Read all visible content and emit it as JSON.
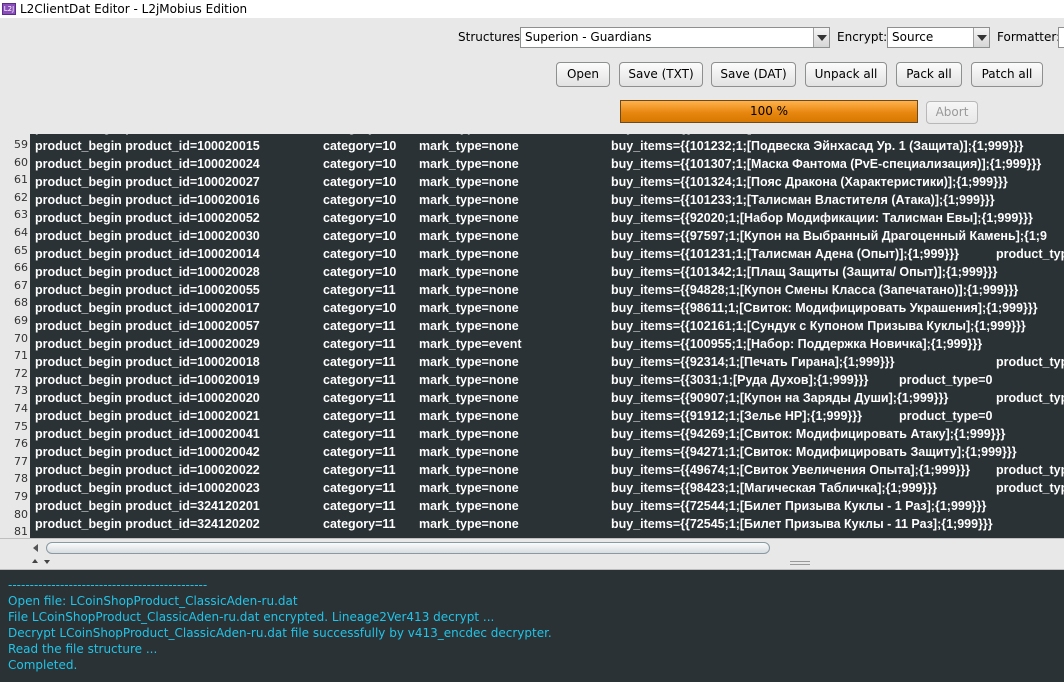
{
  "window": {
    "icon_text": "L2J",
    "title": "L2ClientDat Editor - L2jMobius Edition"
  },
  "toolbar": {
    "structures_label": "Structures",
    "structures_value": "Superion - Guardians",
    "encrypt_label": "Encrypt:",
    "encrypt_value": "Source",
    "formatter_label": "Formatter:",
    "buttons": {
      "open": "Open",
      "save_txt": "Save (TXT)",
      "save_dat": "Save (DAT)",
      "unpack_all": "Unpack all",
      "pack_all": "Pack all",
      "patch_all": "Patch all",
      "abort": "Abort"
    },
    "progress_text": "100 %",
    "progress_value": 1.0
  },
  "table": {
    "partial_top_row": {
      "number": "",
      "product": "product_begin product_id=",
      "category": "category=",
      "mark": "mark_type=",
      "items": "buy_items={{101232;1;[",
      "extra": ""
    },
    "rows": [
      {
        "number": "59",
        "product": "product_begin product_id=100020015",
        "category": "category=10",
        "mark": "mark_type=none",
        "items": "buy_items={{101232;1;[Подвеска Эйнхасад Ур. 1 (Защита)];{1;999}}}",
        "extra": ""
      },
      {
        "number": "60",
        "product": "product_begin product_id=100020024",
        "category": "category=10",
        "mark": "mark_type=none",
        "items": "buy_items={{101307;1;[Маска Фантома (PvE-специализация)];{1;999}}}",
        "extra": ""
      },
      {
        "number": "61",
        "product": "product_begin product_id=100020027",
        "category": "category=10",
        "mark": "mark_type=none",
        "items": "buy_items={{101324;1;[Пояс Дракона (Характеристики)];{1;999}}}",
        "extra": ""
      },
      {
        "number": "62",
        "product": "product_begin product_id=100020016",
        "category": "category=10",
        "mark": "mark_type=none",
        "items": "buy_items={{101233;1;[Талисман Властителя (Атака)];{1;999}}}",
        "extra": ""
      },
      {
        "number": "63",
        "product": "product_begin product_id=100020052",
        "category": "category=10",
        "mark": "mark_type=none",
        "items": "buy_items={{92020;1;[Набор Модификации: Талисман Евы];{1;999}}}",
        "extra": ""
      },
      {
        "number": "64",
        "product": "product_begin product_id=100020030",
        "category": "category=10",
        "mark": "mark_type=none",
        "items": "buy_items={{97597;1;[Купон на Выбранный Драгоценный Камень];{1;9",
        "extra": ""
      },
      {
        "number": "65",
        "product": "product_begin product_id=100020014",
        "category": "category=10",
        "mark": "mark_type=none",
        "items": "buy_items={{101231;1;[Талисман Адена (Опыт)];{1;999}}}",
        "extra": "product_typ"
      },
      {
        "number": "66",
        "product": "product_begin product_id=100020028",
        "category": "category=10",
        "mark": "mark_type=none",
        "items": "buy_items={{101342;1;[Плащ Защиты (Защита/ Опыт)];{1;999}}}",
        "extra": ""
      },
      {
        "number": "67",
        "product": "product_begin product_id=100020055",
        "category": "category=11",
        "mark": "mark_type=none",
        "items": "buy_items={{94828;1;[Купон Смены Класса (Запечатано)];{1;999}}}",
        "extra": ""
      },
      {
        "number": "68",
        "product": "product_begin product_id=100020017",
        "category": "category=10",
        "mark": "mark_type=none",
        "items": "buy_items={{98611;1;[Свиток: Модифицировать Украшения];{1;999}}}",
        "extra": ""
      },
      {
        "number": "69",
        "product": "product_begin product_id=100020057",
        "category": "category=11",
        "mark": "mark_type=none",
        "items": "buy_items={{102161;1;[Сундук с Купоном Призыва Куклы];{1;999}}}",
        "extra": ""
      },
      {
        "number": "70",
        "product": "product_begin product_id=100020029",
        "category": "category=11",
        "mark": "mark_type=event",
        "items": "buy_items={{100955;1;[Набор: Поддержка Новичка];{1;999}}}",
        "extra": ""
      },
      {
        "number": "71",
        "product": "product_begin product_id=100020018",
        "category": "category=11",
        "mark": "mark_type=none",
        "items": "buy_items={{92314;1;[Печать Гирана];{1;999}}}",
        "extra": "product_typ"
      },
      {
        "number": "72",
        "product": "product_begin product_id=100020019",
        "category": "category=11",
        "mark": "mark_type=none",
        "items": "buy_items={{3031;1;[Руда Духов];{1;999}}}",
        "extra": "product_type=0"
      },
      {
        "number": "73",
        "product": "product_begin product_id=100020020",
        "category": "category=11",
        "mark": "mark_type=none",
        "items": "buy_items={{90907;1;[Купон на Заряды Души];{1;999}}}",
        "extra": "product_typ"
      },
      {
        "number": "74",
        "product": "product_begin product_id=100020021",
        "category": "category=11",
        "mark": "mark_type=none",
        "items": "buy_items={{91912;1;[Зелье HP];{1;999}}}",
        "extra": "product_type=0"
      },
      {
        "number": "75",
        "product": "product_begin product_id=100020041",
        "category": "category=11",
        "mark": "mark_type=none",
        "items": "buy_items={{94269;1;[Свиток: Модифицировать Атаку];{1;999}}}",
        "extra": ""
      },
      {
        "number": "76",
        "product": "product_begin product_id=100020042",
        "category": "category=11",
        "mark": "mark_type=none",
        "items": "buy_items={{94271;1;[Свиток: Модифицировать Защиту];{1;999}}}",
        "extra": ""
      },
      {
        "number": "77",
        "product": "product_begin product_id=100020022",
        "category": "category=11",
        "mark": "mark_type=none",
        "items": "buy_items={{49674;1;[Свиток Увеличения Опыта];{1;999}}}",
        "extra": "product_typ"
      },
      {
        "number": "78",
        "product": "product_begin product_id=100020023",
        "category": "category=11",
        "mark": "mark_type=none",
        "items": "buy_items={{98423;1;[Магическая Табличка];{1;999}}}",
        "extra": "product_typ"
      },
      {
        "number": "79",
        "product": "product_begin product_id=324120201",
        "category": "category=11",
        "mark": "mark_type=none",
        "items": "buy_items={{72544;1;[Билет Призыва Куклы - 1 Раз];{1;999}}}",
        "extra": ""
      },
      {
        "number": "80",
        "product": "product_begin product_id=324120202",
        "category": "category=11",
        "mark": "mark_type=none",
        "items": "buy_items={{72545;1;[Билет Призыва Куклы - 11 Раз];{1;999}}}",
        "extra": ""
      }
    ],
    "gutter_numbers": [
      "59",
      "60",
      "61",
      "62",
      "63",
      "64",
      "65",
      "66",
      "67",
      "68",
      "69",
      "70",
      "71",
      "72",
      "73",
      "74",
      "75",
      "76",
      "77",
      "78",
      "79",
      "80",
      "81",
      "82"
    ]
  },
  "log": [
    "----------------------------------------------",
    "Open file: LCoinShopProduct_ClassicAden-ru.dat",
    "File LCoinShopProduct_ClassicAden-ru.dat encrypted. Lineage2Ver413 decrypt ...",
    "Decrypt LCoinShopProduct_ClassicAden-ru.dat file successfully by v413_encdec decrypter.",
    "Read the file structure ...",
    "Completed."
  ],
  "colors": {
    "editor_bg": "#2a3235",
    "log_text": "#22c4e8",
    "progress": "#e88710"
  }
}
